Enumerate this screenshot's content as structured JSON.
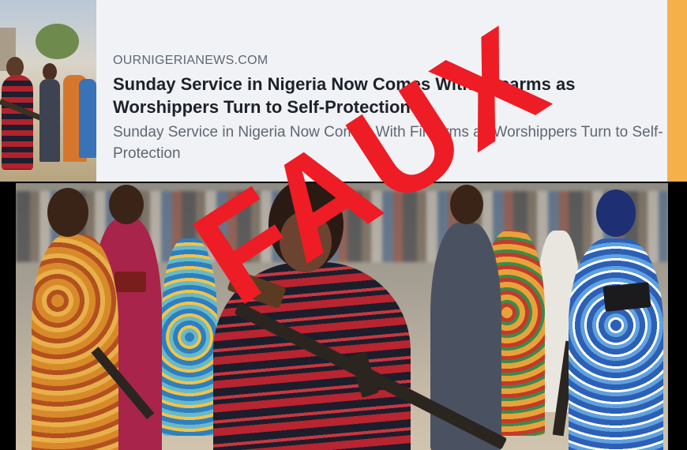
{
  "preview_card": {
    "domain": "OURNIGERIANEWS.COM",
    "title": "Sunday Service in Nigeria Now Comes With Firearms as Worshippers Turn to Self-Protection",
    "description": "Sunday Service in Nigeria Now Comes With Firearms as Worshippers Turn to Self-Protection"
  },
  "stamp": {
    "text": "FAUX",
    "color": "#ee1c25"
  },
  "colors": {
    "card_background": "#f0f2f5",
    "accent_bar": "#f6b04a"
  }
}
